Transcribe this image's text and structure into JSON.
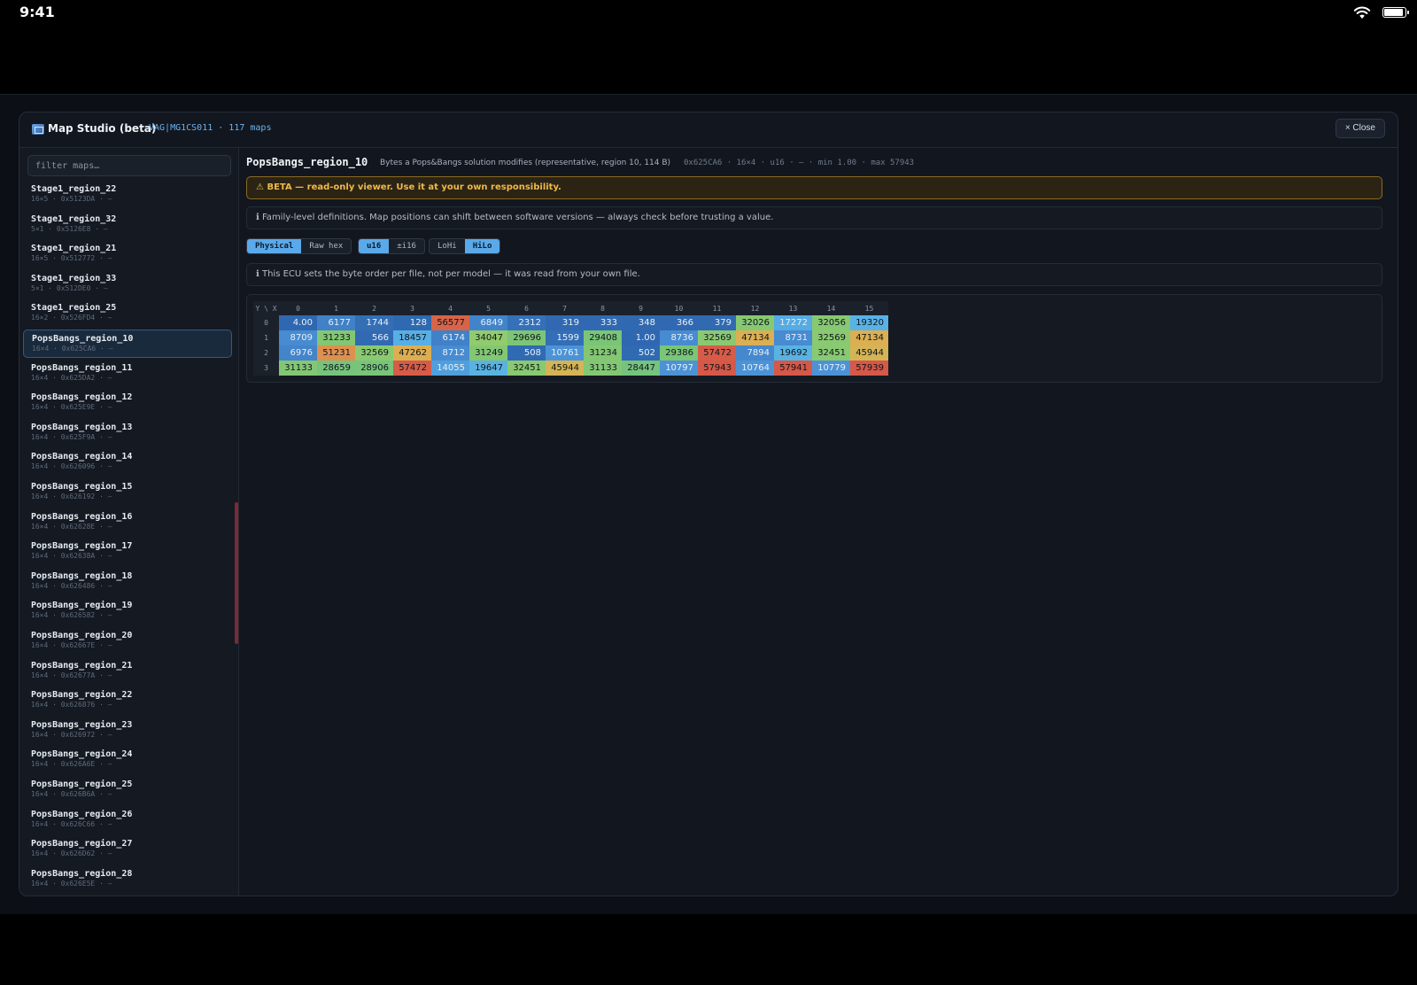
{
  "status_bar": {
    "time": "9:41"
  },
  "modal": {
    "title": "Map Studio (beta)",
    "subtitle": "VAG|MG1CS011 · 117 maps",
    "close_label": "× Close"
  },
  "sidebar": {
    "filter_placeholder": "filter maps…",
    "items": [
      {
        "name": "Stage1_region_22",
        "meta": "16×5 · 0x5123DA · —"
      },
      {
        "name": "Stage1_region_32",
        "meta": "5×1 · 0x5126E8 · —"
      },
      {
        "name": "Stage1_region_21",
        "meta": "16×5 · 0x512772 · —"
      },
      {
        "name": "Stage1_region_33",
        "meta": "5×1 · 0x512DE0 · —"
      },
      {
        "name": "Stage1_region_25",
        "meta": "16×2 · 0x526FD4 · —"
      },
      {
        "name": "PopsBangs_region_10",
        "meta": "16×4 · 0x625CA6 · —",
        "active": true
      },
      {
        "name": "PopsBangs_region_11",
        "meta": "16×4 · 0x625DA2 · —"
      },
      {
        "name": "PopsBangs_region_12",
        "meta": "16×4 · 0x625E9E · —"
      },
      {
        "name": "PopsBangs_region_13",
        "meta": "16×4 · 0x625F9A · —"
      },
      {
        "name": "PopsBangs_region_14",
        "meta": "16×4 · 0x626096 · —"
      },
      {
        "name": "PopsBangs_region_15",
        "meta": "16×4 · 0x626192 · —"
      },
      {
        "name": "PopsBangs_region_16",
        "meta": "16×4 · 0x62628E · —"
      },
      {
        "name": "PopsBangs_region_17",
        "meta": "16×4 · 0x62638A · —"
      },
      {
        "name": "PopsBangs_region_18",
        "meta": "16×4 · 0x626486 · —"
      },
      {
        "name": "PopsBangs_region_19",
        "meta": "16×4 · 0x626582 · —"
      },
      {
        "name": "PopsBangs_region_20",
        "meta": "16×4 · 0x62667E · —"
      },
      {
        "name": "PopsBangs_region_21",
        "meta": "16×4 · 0x62677A · —"
      },
      {
        "name": "PopsBangs_region_22",
        "meta": "16×4 · 0x626876 · —"
      },
      {
        "name": "PopsBangs_region_23",
        "meta": "16×4 · 0x626972 · —"
      },
      {
        "name": "PopsBangs_region_24",
        "meta": "16×4 · 0x626A6E · —"
      },
      {
        "name": "PopsBangs_region_25",
        "meta": "16×4 · 0x626B6A · —"
      },
      {
        "name": "PopsBangs_region_26",
        "meta": "16×4 · 0x626C66 · —"
      },
      {
        "name": "PopsBangs_region_27",
        "meta": "16×4 · 0x626D62 · —"
      },
      {
        "name": "PopsBangs_region_28",
        "meta": "16×4 · 0x626E5E · —"
      }
    ]
  },
  "map": {
    "name": "PopsBangs_region_10",
    "description": "Bytes a Pops&Bangs solution modifies (representative, region 10, 114 B)",
    "stats": "0x625CA6 · 16×4 · u16 · — · min 1.00 · max 57943",
    "warning": "⚠ BETA — read-only viewer. Use it at your own responsibility.",
    "info_family": "ℹ Family-level definitions. Map positions can shift between software versions — always check before trusting a value.",
    "info_byteorder": "ℹ This ECU sets the byte order per file, not per model — it was read from your own file."
  },
  "toggles": {
    "mode": [
      {
        "label": "Physical",
        "on": true
      },
      {
        "label": "Raw hex",
        "on": false
      }
    ],
    "type": [
      {
        "label": "u16",
        "on": true
      },
      {
        "label": "±i16",
        "on": false
      }
    ],
    "order": [
      {
        "label": "LoHi",
        "on": false
      },
      {
        "label": "HiLo",
        "on": true
      }
    ]
  },
  "grid": {
    "corner": "Y \\ X",
    "columns": [
      "0",
      "1",
      "2",
      "3",
      "4",
      "5",
      "6",
      "7",
      "8",
      "9",
      "10",
      "11",
      "12",
      "13",
      "14",
      "15"
    ],
    "rows": [
      "0",
      "1",
      "2",
      "3"
    ],
    "min": 1,
    "max": 57943,
    "values": [
      [
        "4.00",
        "6177",
        "1744",
        "128",
        "56577",
        "6849",
        "2312",
        "319",
        "333",
        "348",
        "366",
        "379",
        "32026",
        "17272",
        "32056",
        "19320"
      ],
      [
        "8709",
        "31233",
        "566",
        "18457",
        "6174",
        "34047",
        "29696",
        "1599",
        "29408",
        "1.00",
        "8736",
        "32569",
        "47134",
        "8731",
        "32569",
        "47134"
      ],
      [
        "6976",
        "51231",
        "32569",
        "47262",
        "8712",
        "31249",
        "508",
        "10761",
        "31234",
        "502",
        "29386",
        "57472",
        "7894",
        "19692",
        "32451",
        "45944"
      ],
      [
        "31133",
        "28659",
        "28906",
        "57472",
        "14055",
        "19647",
        "32451",
        "45944",
        "31133",
        "28447",
        "10797",
        "57943",
        "10764",
        "57941",
        "10779",
        "57939"
      ]
    ]
  }
}
